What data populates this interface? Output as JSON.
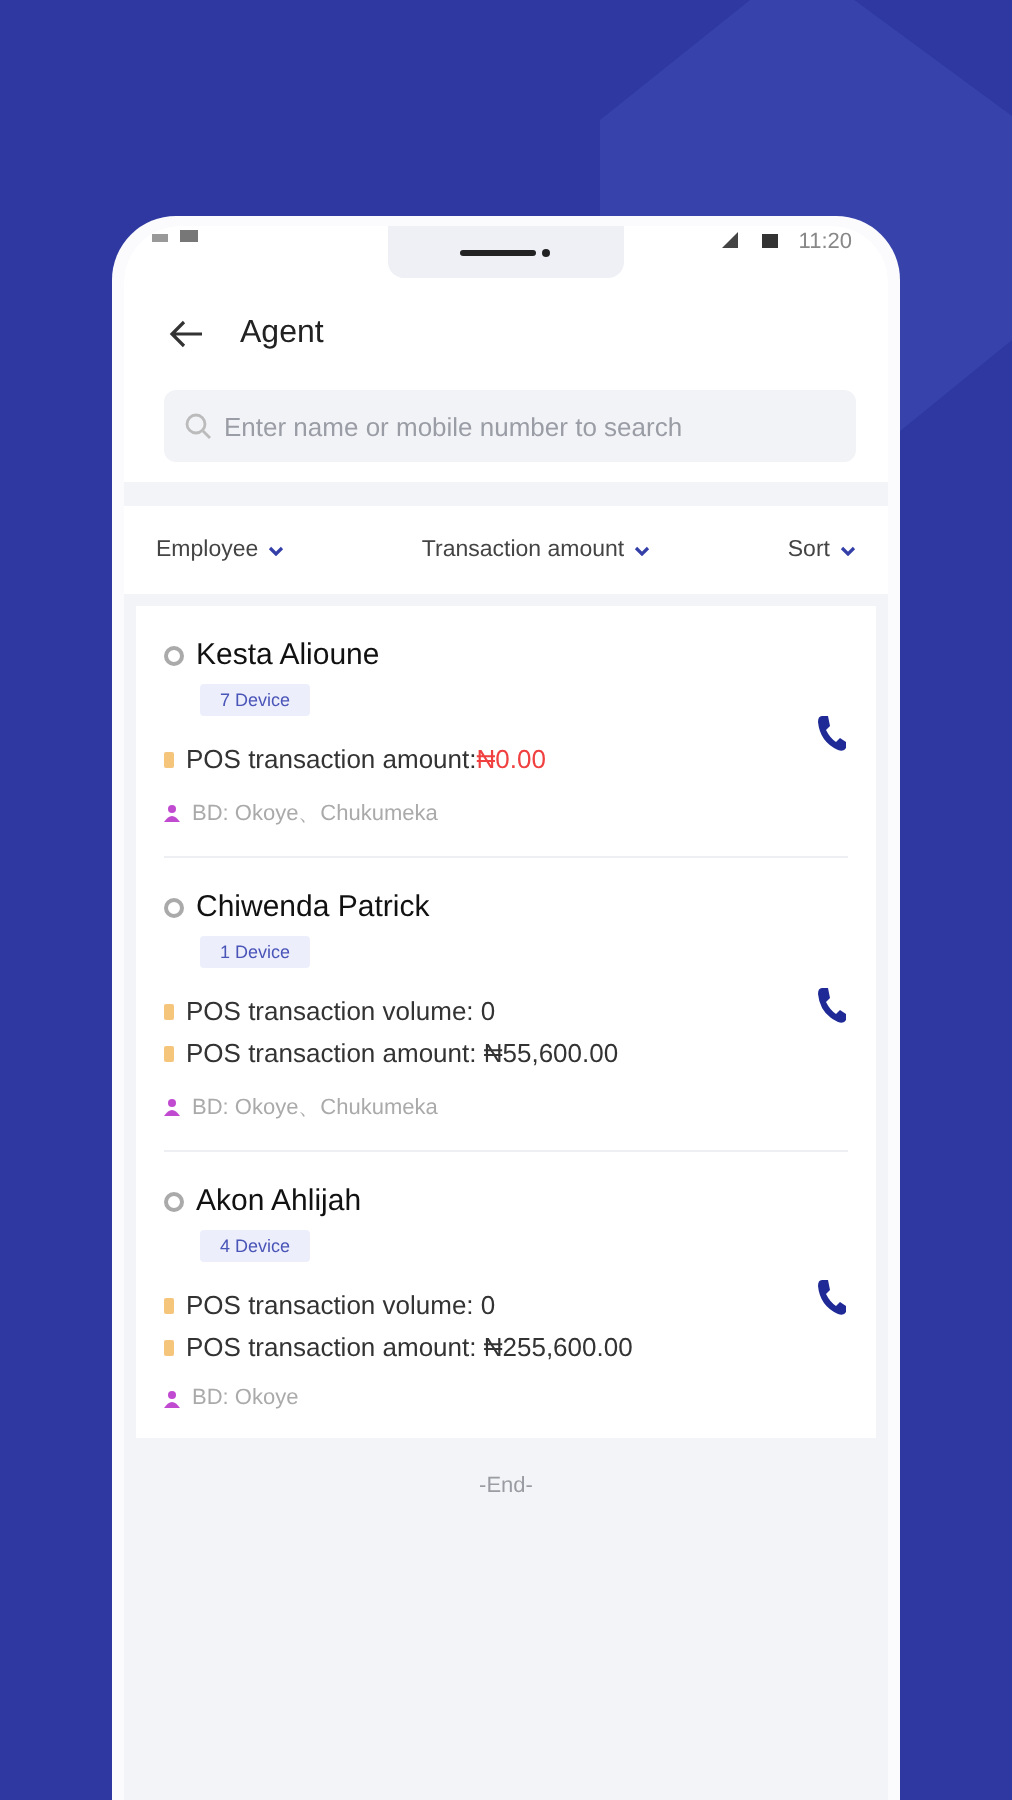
{
  "status_bar": {
    "time": "11:20"
  },
  "header": {
    "title": "Agent"
  },
  "search": {
    "placeholder": "Enter name or mobile number to search"
  },
  "filters": [
    {
      "label": "Employee"
    },
    {
      "label": "Transaction amount"
    },
    {
      "label": "Sort"
    }
  ],
  "agents": [
    {
      "name": "Kesta Alioune",
      "devices": "7 Device",
      "stats": [
        {
          "label": "POS transaction amount:",
          "value": "₦0.00",
          "highlight": true
        }
      ],
      "bd": "BD: Okoye、Chukumeka"
    },
    {
      "name": "Chiwenda Patrick",
      "devices": "1 Device",
      "stats": [
        {
          "label": "POS transaction volume: ",
          "value": "0",
          "highlight": false
        },
        {
          "label": "POS transaction amount: ",
          "value": "₦55,600.00",
          "highlight": false
        }
      ],
      "bd": "BD: Okoye、Chukumeka"
    },
    {
      "name": "Akon Ahlijah",
      "devices": "4 Device",
      "stats": [
        {
          "label": "POS transaction volume: ",
          "value": "0",
          "highlight": false
        },
        {
          "label": "POS transaction amount: ",
          "value": "₦255,600.00",
          "highlight": false
        }
      ],
      "bd": "BD: Okoye"
    }
  ],
  "footer": "-End-"
}
